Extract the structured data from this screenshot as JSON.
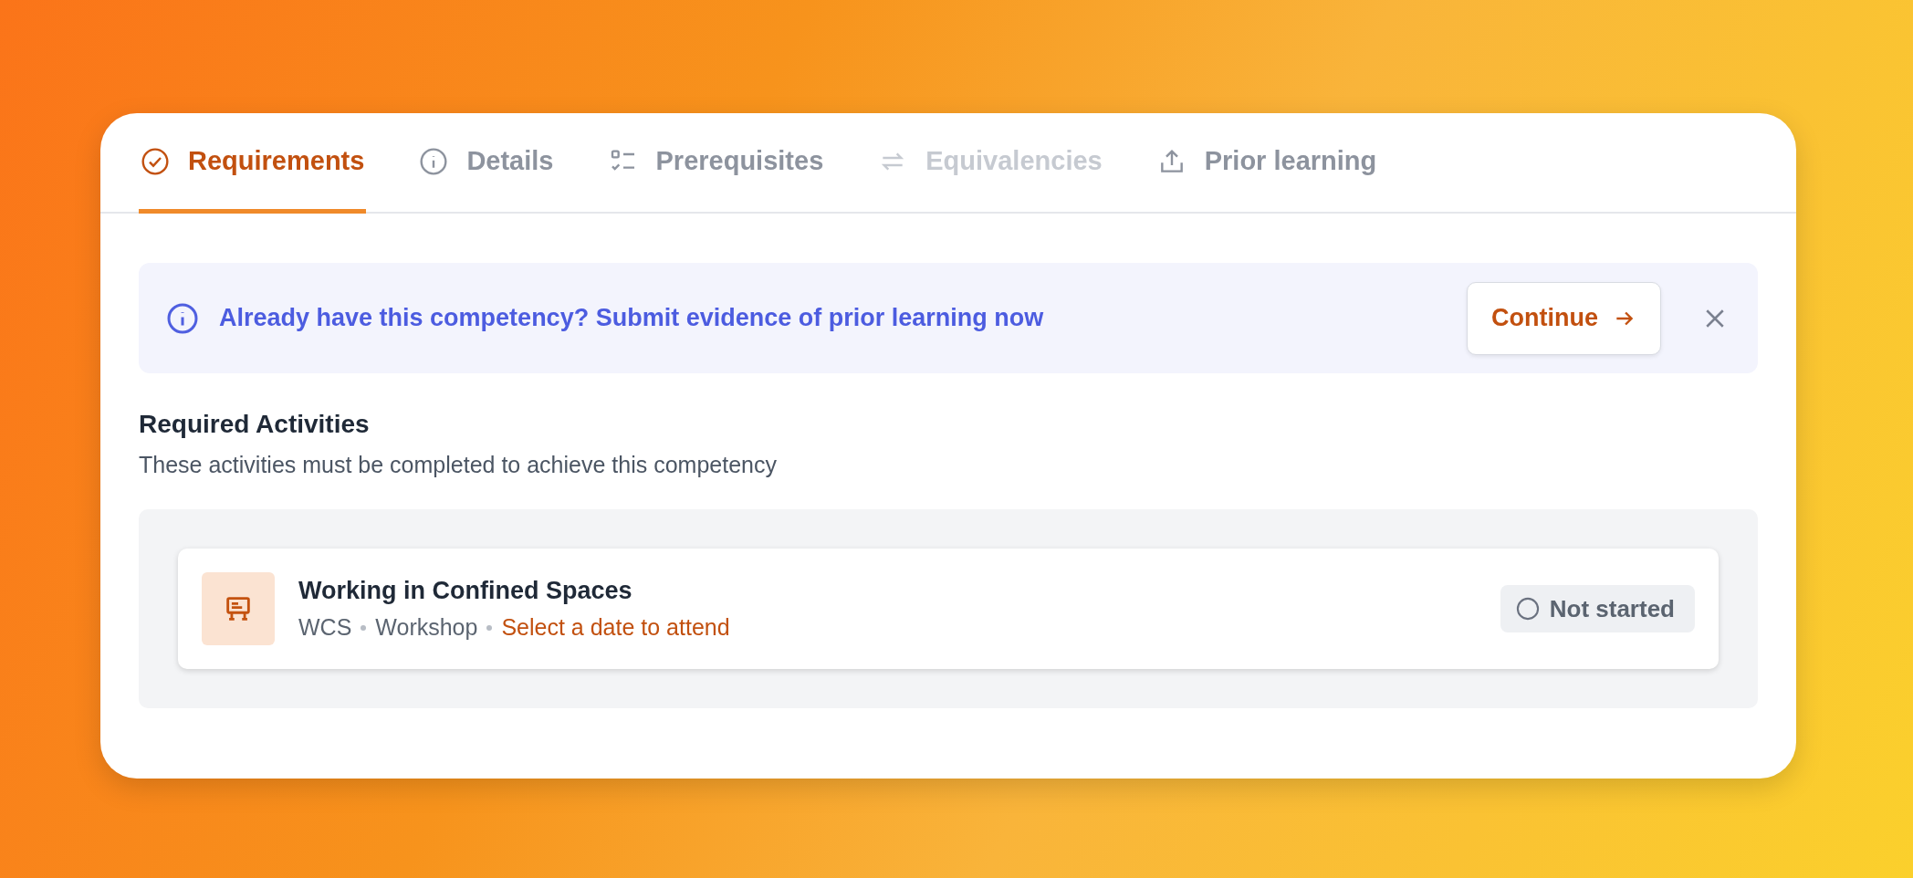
{
  "tabs": [
    {
      "label": "Requirements",
      "kind": "check",
      "selected": true,
      "disabled": false
    },
    {
      "label": "Details",
      "kind": "info",
      "selected": false,
      "disabled": false
    },
    {
      "label": "Prerequisites",
      "kind": "checklist",
      "selected": false,
      "disabled": false
    },
    {
      "label": "Equivalencies",
      "kind": "swap",
      "selected": false,
      "disabled": true
    },
    {
      "label": "Prior learning",
      "kind": "upload",
      "selected": false,
      "disabled": false
    }
  ],
  "banner": {
    "message": "Already have this competency? Submit evidence of prior learning now",
    "button": "Continue"
  },
  "section": {
    "title": "Required Activities",
    "subtitle": "These activities must be completed to achieve this competency"
  },
  "activities": [
    {
      "title": "Working in Confined Spaces",
      "code": "WCS",
      "type": "Workshop",
      "action": "Select a date to attend",
      "status": "Not started"
    }
  ]
}
